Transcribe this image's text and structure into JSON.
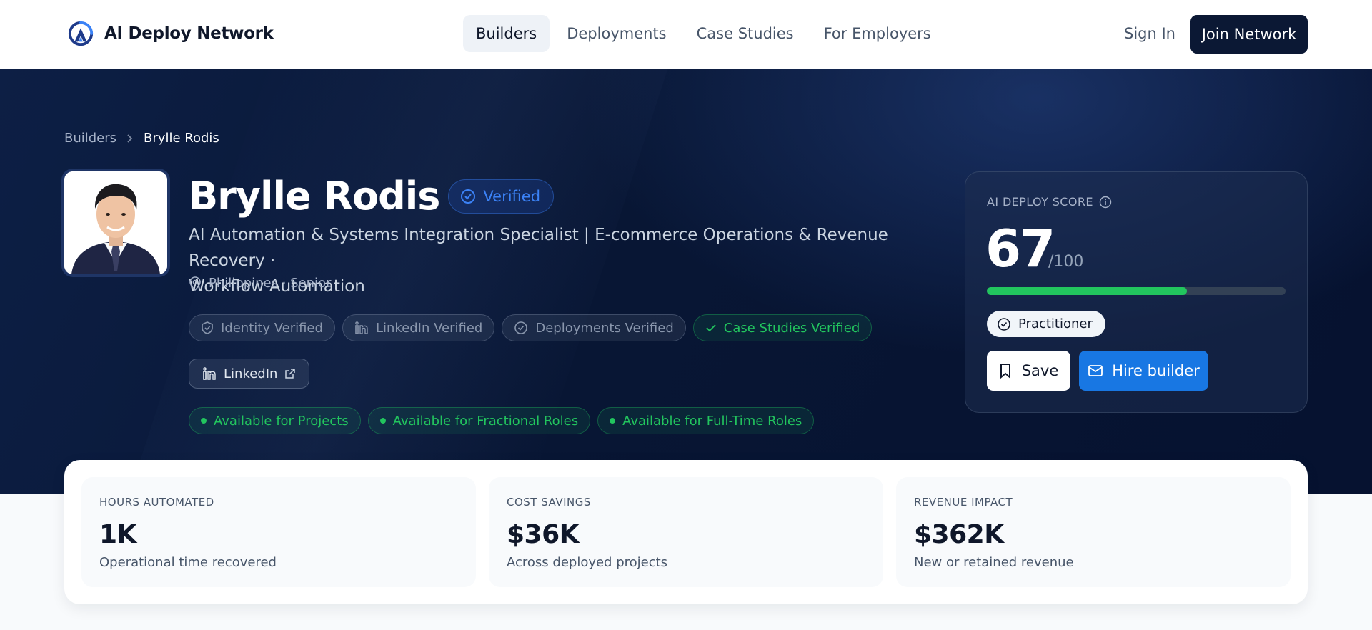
{
  "brand": {
    "name": "AI Deploy Network"
  },
  "nav": {
    "links": [
      "Builders",
      "Deployments",
      "Case Studies",
      "For Employers"
    ],
    "active": 0,
    "sign_in": "Sign In",
    "join": "Join Network"
  },
  "breadcrumb": {
    "parent": "Builders",
    "current": "Brylle Rodis"
  },
  "profile": {
    "name": "Brylle Rodis",
    "verified_label": "Verified",
    "headline_line1": "AI Automation & Systems Integration Specialist | E-commerce Operations & Revenue Recovery ·",
    "headline_line2": "Workflow Automation",
    "location": "Philippines · Senior",
    "verifications": [
      {
        "label": "Identity Verified",
        "state": "gray",
        "icon": "shield-icon"
      },
      {
        "label": "LinkedIn Verified",
        "state": "gray",
        "icon": "linkedin-icon"
      },
      {
        "label": "Deployments Verified",
        "state": "gray",
        "icon": "check-circle-icon"
      },
      {
        "label": "Case Studies Verified",
        "state": "green",
        "icon": "check-icon"
      }
    ],
    "linkedin_label": "LinkedIn",
    "availability": [
      "Available for Projects",
      "Available for Fractional Roles",
      "Available for Full-Time Roles"
    ]
  },
  "score": {
    "label": "AI DEPLOY SCORE",
    "value": "67",
    "max": "/100",
    "fraction": 0.67,
    "tier": "Practitioner",
    "save": "Save",
    "hire": "Hire builder"
  },
  "metrics": [
    {
      "label": "HOURS AUTOMATED",
      "value": "1K",
      "sub": "Operational time recovered"
    },
    {
      "label": "COST SAVINGS",
      "value": "$36K",
      "sub": "Across deployed projects"
    },
    {
      "label": "REVENUE IMPACT",
      "value": "$362K",
      "sub": "New or retained revenue"
    }
  ],
  "colors": {
    "accent_blue": "#1877e3",
    "success_green": "#22c55e",
    "navy": "#0b1834"
  }
}
